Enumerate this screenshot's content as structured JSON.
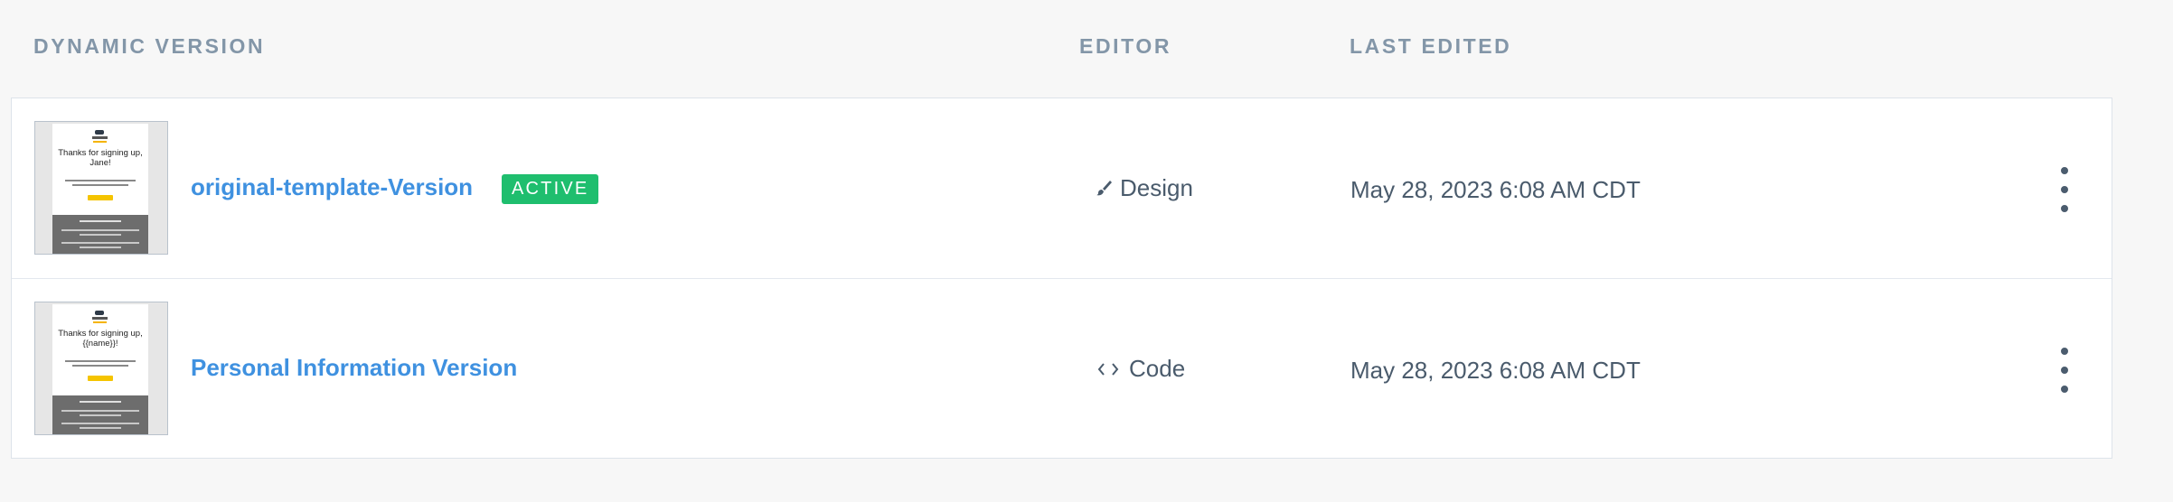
{
  "columns": {
    "version": "DYNAMIC VERSION",
    "editor": "EDITOR",
    "last_edited": "LAST EDITED"
  },
  "rows": [
    {
      "name": "original-template-Version",
      "badge": "ACTIVE",
      "editor_icon": "brush-icon",
      "editor": "Design",
      "last_edited": "May 28, 2023 6:08 AM CDT",
      "thumbnail_title": "Thanks for signing up, Jane!"
    },
    {
      "name": "Personal Information Version",
      "badge": "",
      "editor_icon": "code-icon",
      "editor": "Code",
      "last_edited": "May 28, 2023 6:08 AM CDT",
      "thumbnail_title": "Thanks for signing up, {{name}}!"
    }
  ],
  "colors": {
    "link": "#3f91e0",
    "active_badge": "#1fbe6e",
    "header_text": "#8396a8",
    "body_text": "#4a5b6c"
  }
}
